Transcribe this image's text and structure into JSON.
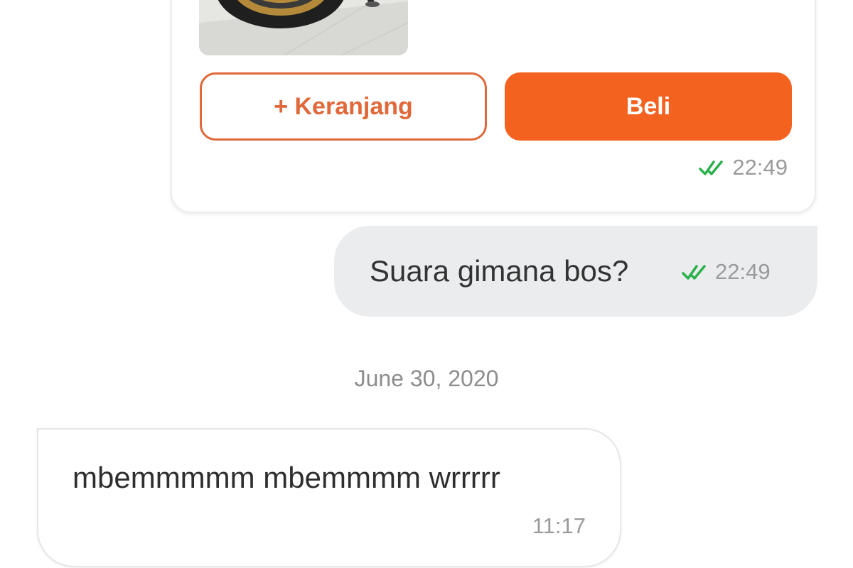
{
  "product_card": {
    "cart_button_label": "+ Keranjang",
    "buy_button_label": "Beli",
    "time": "22:49",
    "read_status": "double-check-icon"
  },
  "outgoing_message": {
    "text": "Suara gimana bos?",
    "time": "22:49",
    "read_status": "double-check-icon"
  },
  "date_separator": "June 30, 2020",
  "incoming_message": {
    "text": "mbemmmmm mbemmmm wrrrrr",
    "time": "11:17"
  },
  "colors": {
    "accent": "#f4621f",
    "accent_outline": "#e0683a",
    "read_tick": "#2bb24c",
    "outgoing_bubble": "#eaecee",
    "meta_text": "#9a9a9a"
  }
}
